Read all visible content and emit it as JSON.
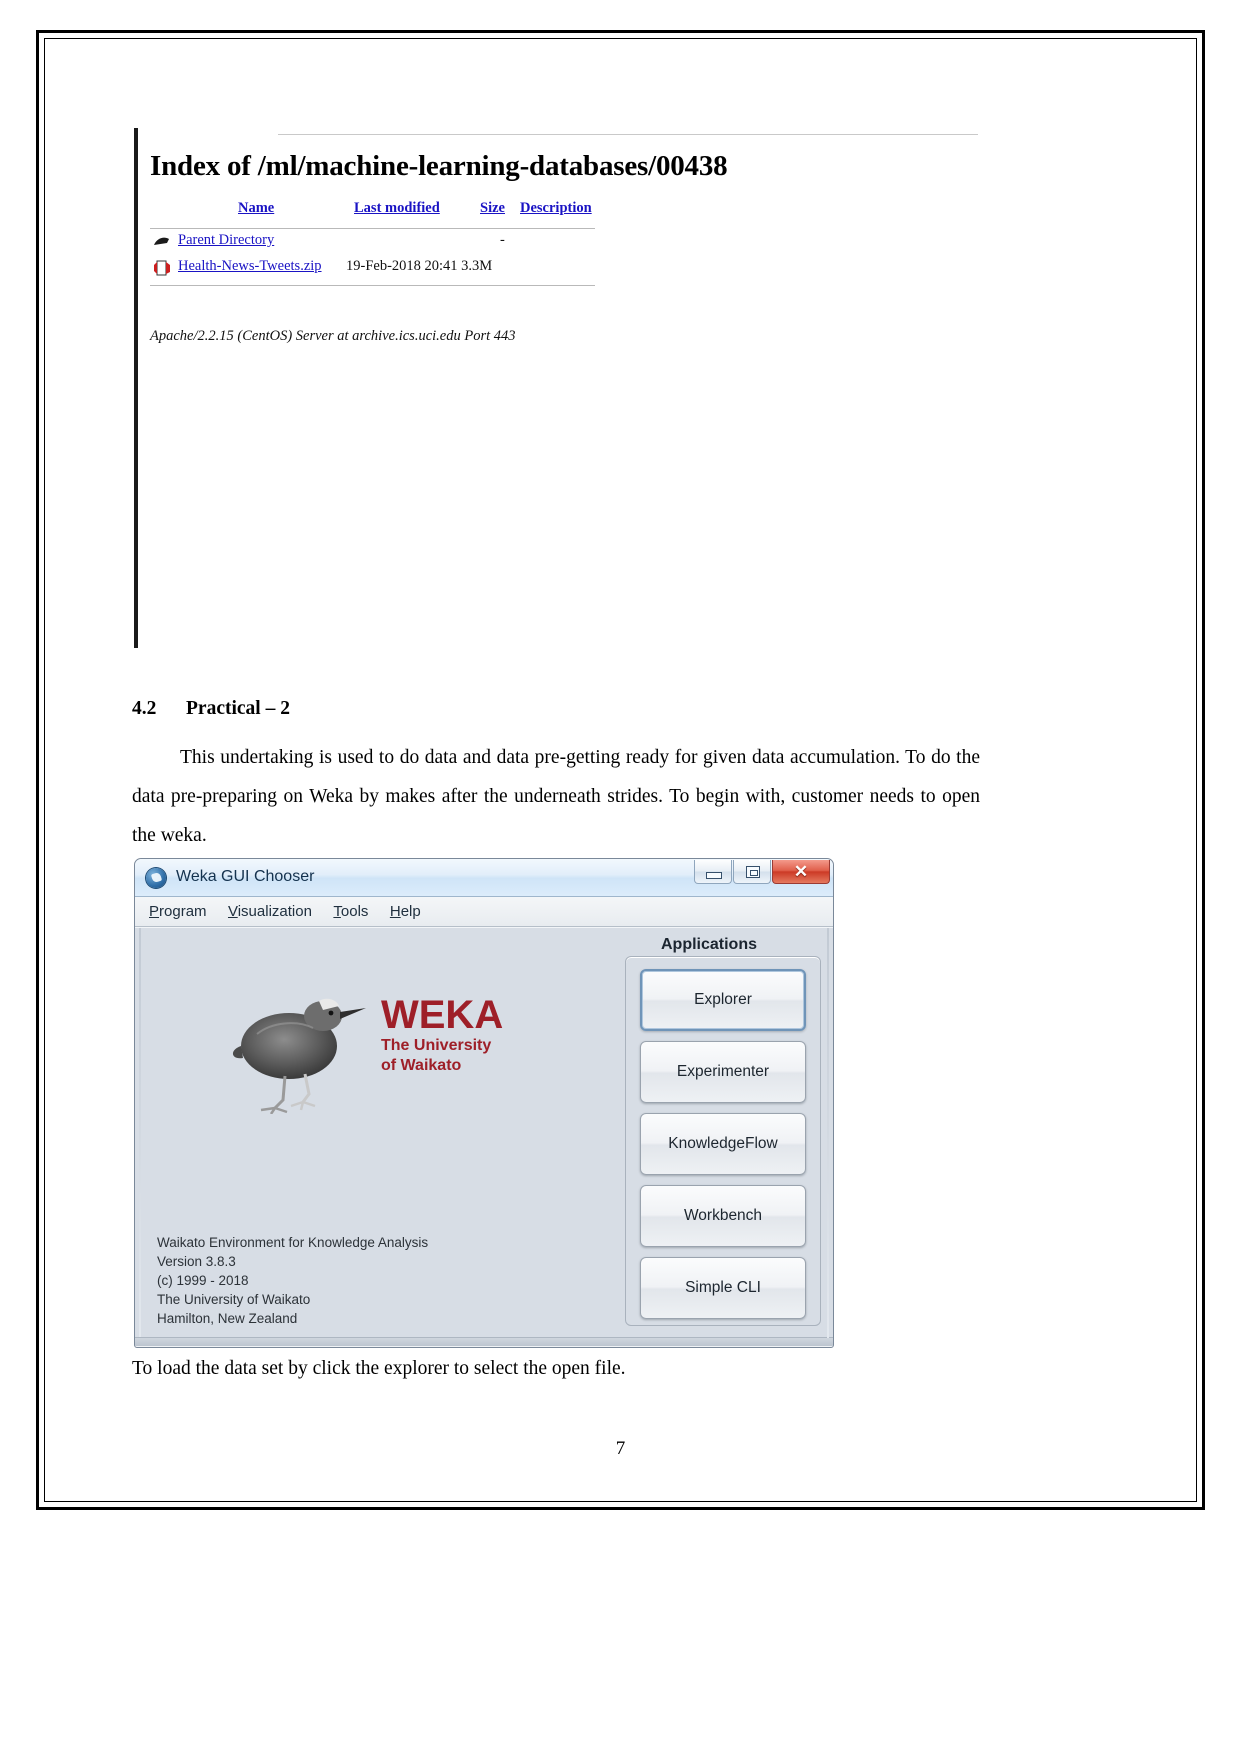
{
  "apache": {
    "heading": "Index of /ml/machine-learning-databases/00438",
    "columns": {
      "name": "Name",
      "last_modified": "Last modified",
      "size": "Size",
      "description": "Description"
    },
    "rows": [
      {
        "icon": "parent-directory-icon",
        "link": "Parent Directory",
        "meta": "-"
      },
      {
        "icon": "zip-file-icon",
        "link": "Health-News-Tweets.zip",
        "meta": "19-Feb-2018 20:41  3.3M"
      }
    ],
    "signature": "Apache/2.2.15 (CentOS) Server at archive.ics.uci.edu Port 443",
    "link_color": "#1a13c4"
  },
  "section": {
    "number": "4.2",
    "title": "Practical – 2",
    "paragraph": "This undertaking is used to do data and data pre-getting ready for given data accumulation. To do the data pre-preparing on Weka by makes after the underneath strides. To begin with, customer needs to open the weka.",
    "caption": "To load the data set by click the explorer to select the open file."
  },
  "weka": {
    "window_title": "Weka GUI Chooser",
    "window_controls": {
      "minimize": "–",
      "maximize": "□",
      "close": "✕"
    },
    "menu": [
      {
        "mnemonic": "P",
        "rest": "rogram"
      },
      {
        "mnemonic": "V",
        "rest": "isualization"
      },
      {
        "mnemonic": "T",
        "rest": "ools"
      },
      {
        "mnemonic": "H",
        "rest": "elp"
      }
    ],
    "logo": {
      "wordmark": "WEKA",
      "sub_line1": "The University",
      "sub_line2": "of Waikato",
      "color": "#9e1f28"
    },
    "about": [
      "Waikato Environment for Knowledge Analysis",
      "Version 3.8.3",
      "(c) 1999 - 2018",
      "The University of Waikato",
      "Hamilton, New Zealand"
    ],
    "applications_label": "Applications",
    "buttons": [
      {
        "label": "Explorer",
        "focused": true
      },
      {
        "label": "Experimenter",
        "focused": false
      },
      {
        "label": "KnowledgeFlow",
        "focused": false
      },
      {
        "label": "Workbench",
        "focused": false
      },
      {
        "label": "Simple CLI",
        "focused": false
      }
    ]
  },
  "page": {
    "number": "7"
  }
}
